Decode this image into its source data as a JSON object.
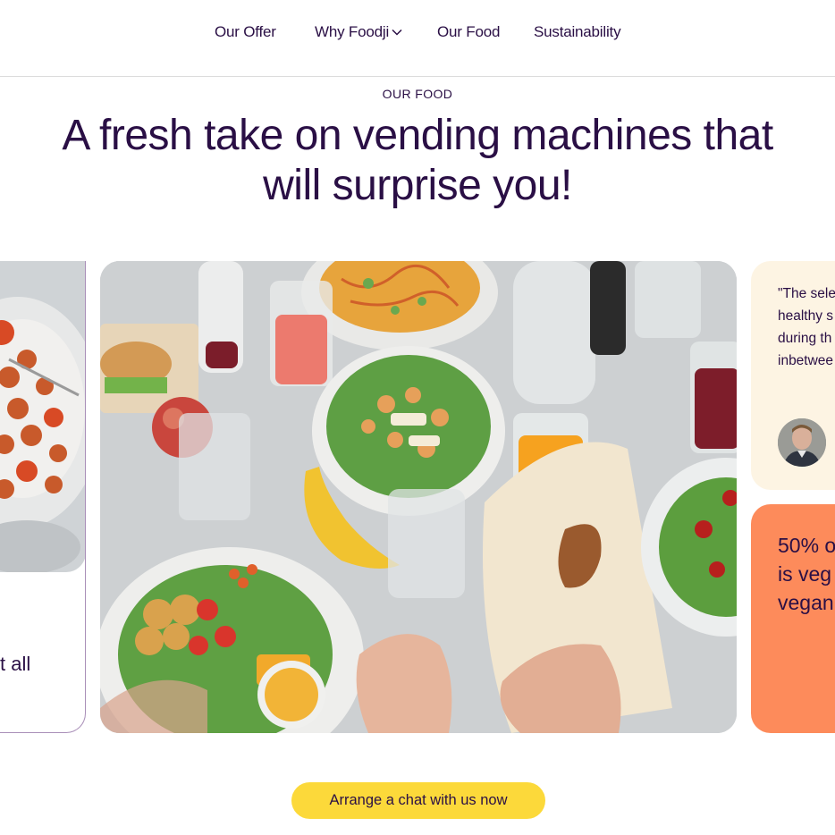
{
  "nav": {
    "items": [
      {
        "label": "Our Offer"
      },
      {
        "label": "Why Foodji",
        "has_dropdown": true
      },
      {
        "label": "Our Food"
      },
      {
        "label": "Sustainability"
      }
    ]
  },
  "hero": {
    "eyebrow": "OUR FOOD",
    "title_line1": "A fresh take on vending machines that",
    "title_line2": "will surprise you!"
  },
  "carousel": {
    "left_card": {
      "snippet": "t all"
    },
    "main_card": {
      "image": "table-of-fresh-meals-photo"
    },
    "quote_card": {
      "lines": [
        "\"The sele",
        "healthy s",
        "during th",
        "inbetwee"
      ]
    },
    "stat_card": {
      "lines": [
        "50% o",
        "is veg",
        "vegan"
      ]
    }
  },
  "cta": {
    "label": "Arrange a chat with us now"
  },
  "colors": {
    "text": "#2a0f45",
    "cta_bg": "#fcd93a",
    "quote_bg": "#fdf4e3",
    "stat_bg": "#fd8b5b"
  }
}
